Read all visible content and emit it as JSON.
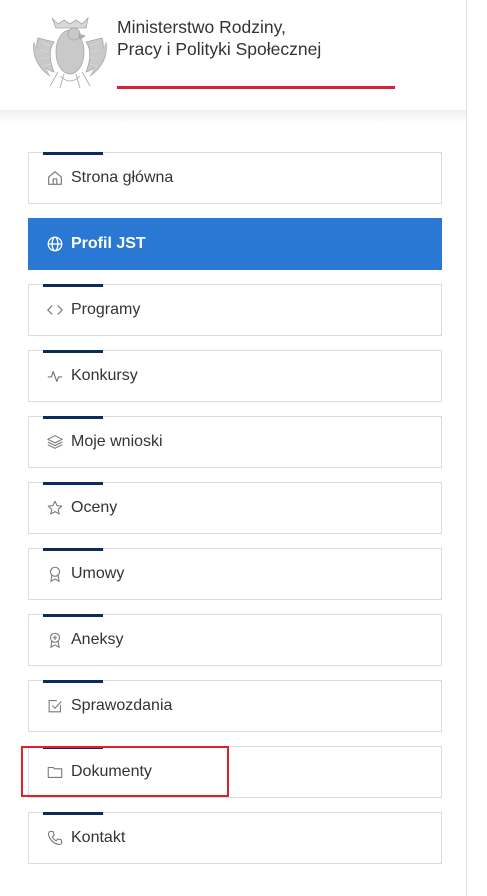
{
  "header": {
    "ministry_line1": "Ministerstwo Rodziny,",
    "ministry_line2": "Pracy i Polityki Społecznej",
    "logo_icon": "polish-eagle-emblem",
    "accent_color": "#d4213d"
  },
  "menu": {
    "active_color": "#2978d3",
    "items": [
      {
        "label": "Strona główna",
        "icon": "home-icon"
      },
      {
        "label": "Profil JST",
        "icon": "globe-icon",
        "active": true
      },
      {
        "label": "Programy",
        "icon": "code-icon"
      },
      {
        "label": "Konkursy",
        "icon": "pulse-icon"
      },
      {
        "label": "Moje wnioski",
        "icon": "layers-icon"
      },
      {
        "label": "Oceny",
        "icon": "star-icon"
      },
      {
        "label": "Umowy",
        "icon": "award-icon"
      },
      {
        "label": "Aneksy",
        "icon": "medal-icon"
      },
      {
        "label": "Sprawozdania",
        "icon": "checkbox-icon"
      },
      {
        "label": "Dokumenty",
        "icon": "folder-icon",
        "highlighted": true
      },
      {
        "label": "Kontakt",
        "icon": "phone-icon"
      }
    ]
  }
}
